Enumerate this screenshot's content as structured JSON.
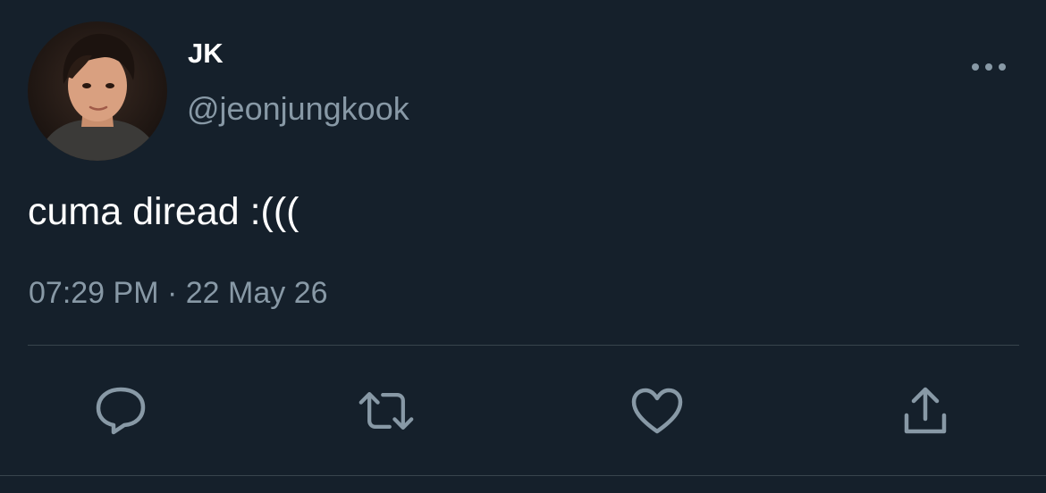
{
  "tweet": {
    "author": {
      "display_name": "JK",
      "handle": "@jeonjungkook",
      "avatar_icon": "profile-photo"
    },
    "text": "cuma diread :(((",
    "time": "07:29 PM",
    "separator": " · ",
    "date": "22 May 26",
    "more_icon": "ellipsis-icon"
  },
  "actions": [
    {
      "name": "reply",
      "icon": "comment-icon"
    },
    {
      "name": "retweet",
      "icon": "retweet-icon"
    },
    {
      "name": "like",
      "icon": "heart-icon"
    },
    {
      "name": "share",
      "icon": "share-icon"
    }
  ],
  "colors": {
    "background": "#15202b",
    "primary_text": "#ffffff",
    "secondary_text": "#8899a6",
    "divider": "#38444d"
  }
}
